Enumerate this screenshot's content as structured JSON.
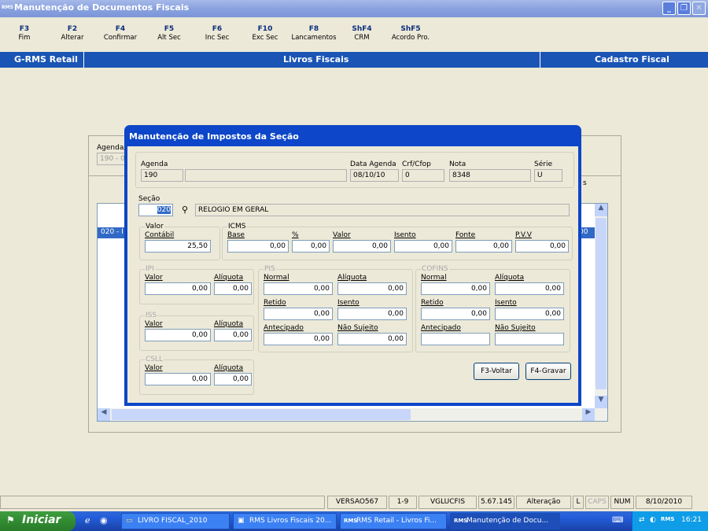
{
  "window": {
    "title": "Manutenção de Documentos Fiscais",
    "icon_text": "RMS"
  },
  "fkeys": [
    {
      "key": "F3",
      "label": "Fim"
    },
    {
      "key": "F2",
      "label": "Alterar"
    },
    {
      "key": "F4",
      "label": "Confirmar"
    },
    {
      "key": "F5",
      "label": "Alt Sec"
    },
    {
      "key": "F6",
      "label": "Inc Sec"
    },
    {
      "key": "F10",
      "label": "Exc Sec"
    },
    {
      "key": "F8",
      "label": "Lancamentos"
    },
    {
      "key": "ShF4",
      "label": "CRM"
    },
    {
      "key": "ShF5",
      "label": "Acordo Pro."
    }
  ],
  "header": {
    "left": "G-RMS Retail",
    "center": "Livros Fiscais",
    "right": "Cadastro Fiscal"
  },
  "background": {
    "agenda_label": "Agenda/",
    "agenda_value": "190 - 00",
    "row_left": "020 - I",
    "row_right": "00",
    "tab_right": "s"
  },
  "dialog": {
    "title": "Manutenção de Impostos da Seção",
    "agenda": {
      "label": "Agenda",
      "value": "190",
      "desc": ""
    },
    "data_agenda": {
      "label": "Data Agenda",
      "value": "08/10/10"
    },
    "crf": {
      "label": "Crf/Cfop",
      "value": "0"
    },
    "nota": {
      "label": "Nota",
      "value": "8348"
    },
    "serie": {
      "label": "Série",
      "value": "U"
    },
    "secao": {
      "label": "Seção",
      "value": "020",
      "desc": "RELOGIO EM GERAL"
    },
    "valor": {
      "group": "Valor",
      "label": "Contábil",
      "value": "25,50"
    },
    "icms": {
      "group": "ICMS",
      "base": {
        "label": "Base",
        "value": "0,00"
      },
      "pct": {
        "label": "%",
        "value": "0,00"
      },
      "valor": {
        "label": "Valor",
        "value": "0,00"
      },
      "isento": {
        "label": "Isento",
        "value": "0,00"
      },
      "fonte": {
        "label": "Fonte",
        "value": "0,00"
      },
      "pvv": {
        "label": "P.V.V",
        "value": "0,00"
      }
    },
    "ipi": {
      "group": "IPI",
      "valor": {
        "label": "Valor",
        "value": "0,00"
      },
      "aliquota": {
        "label": "Alíquota",
        "value": "0,00"
      }
    },
    "iss": {
      "group": "ISS",
      "valor": {
        "label": "Valor",
        "value": "0,00"
      },
      "aliquota": {
        "label": "Alíquota",
        "value": "0,00"
      }
    },
    "csll": {
      "group": "CSLL",
      "valor": {
        "label": "Valor",
        "value": "0,00"
      },
      "aliquota": {
        "label": "Alíquota",
        "value": "0,00"
      }
    },
    "pis": {
      "group": "PIS",
      "normal": {
        "label": "Normal",
        "value": "0,00"
      },
      "aliquota": {
        "label": "Alíquota",
        "value": "0,00"
      },
      "retido": {
        "label": "Retido",
        "value": "0,00"
      },
      "isento": {
        "label": "Isento",
        "value": "0,00"
      },
      "antecipado": {
        "label": "Antecipado",
        "value": "0,00"
      },
      "nao_sujeito": {
        "label": "Não Sujeito",
        "value": "0,00"
      }
    },
    "cofins": {
      "group": "COFINS",
      "normal": {
        "label": "Normal",
        "value": "0,00"
      },
      "aliquota": {
        "label": "Alíquota",
        "value": "0,00"
      },
      "retido": {
        "label": "Retido",
        "value": "0,00"
      },
      "isento": {
        "label": "Isento",
        "value": "0,00"
      },
      "antecipado": {
        "label": "Antecipado",
        "value": ""
      },
      "nao_sujeito": {
        "label": "Não Sujeito",
        "value": ""
      }
    },
    "buttons": {
      "voltar": "F3-Voltar",
      "gravar": "F4-Gravar"
    }
  },
  "status": {
    "version": "VERSAO567",
    "range": "1-9",
    "user": "VGLUCFIS",
    "build": "5.67.145",
    "mode": "Alteração",
    "l": "L",
    "caps": "CAPS",
    "num": "NUM",
    "date": "8/10/2010"
  },
  "taskbar": {
    "start": "Iniciar",
    "tasks": [
      "LIVRO FISCAL_2010",
      "RMS Livros Fiscais 20...",
      "RMS Retail - Livros Fi...",
      "Manutenção de Docu..."
    ],
    "clock": "16:21"
  },
  "colors": {
    "titlebar": "#8aa2df",
    "header_bar": "#1a55b5",
    "dialog_frame": "#0d46c8",
    "taskbar": "#245edb",
    "start": "#318c31"
  }
}
